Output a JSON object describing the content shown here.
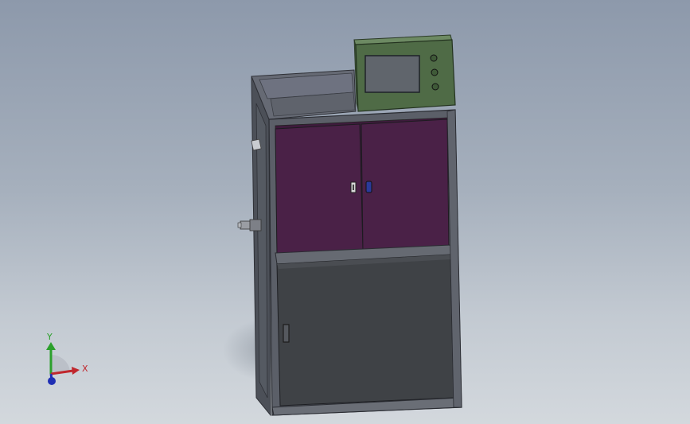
{
  "viewport": {
    "background_top": "#8d99ab",
    "background_bottom": "#d3d8dd"
  },
  "model": {
    "frame_color": "#5b5f68",
    "frame_shadow": "#3d4048",
    "upper_door_color": "#4a2147",
    "lower_door_color": "#3f4246",
    "hmi_box_color": "#4f6b46",
    "hmi_screen_color": "#60656c",
    "hmi_buttons": 3
  },
  "triad": {
    "x_label": "X",
    "y_label": "Y",
    "x_color": "#c0272d",
    "y_color": "#2ca02c",
    "z_color": "#1f2fb4"
  }
}
